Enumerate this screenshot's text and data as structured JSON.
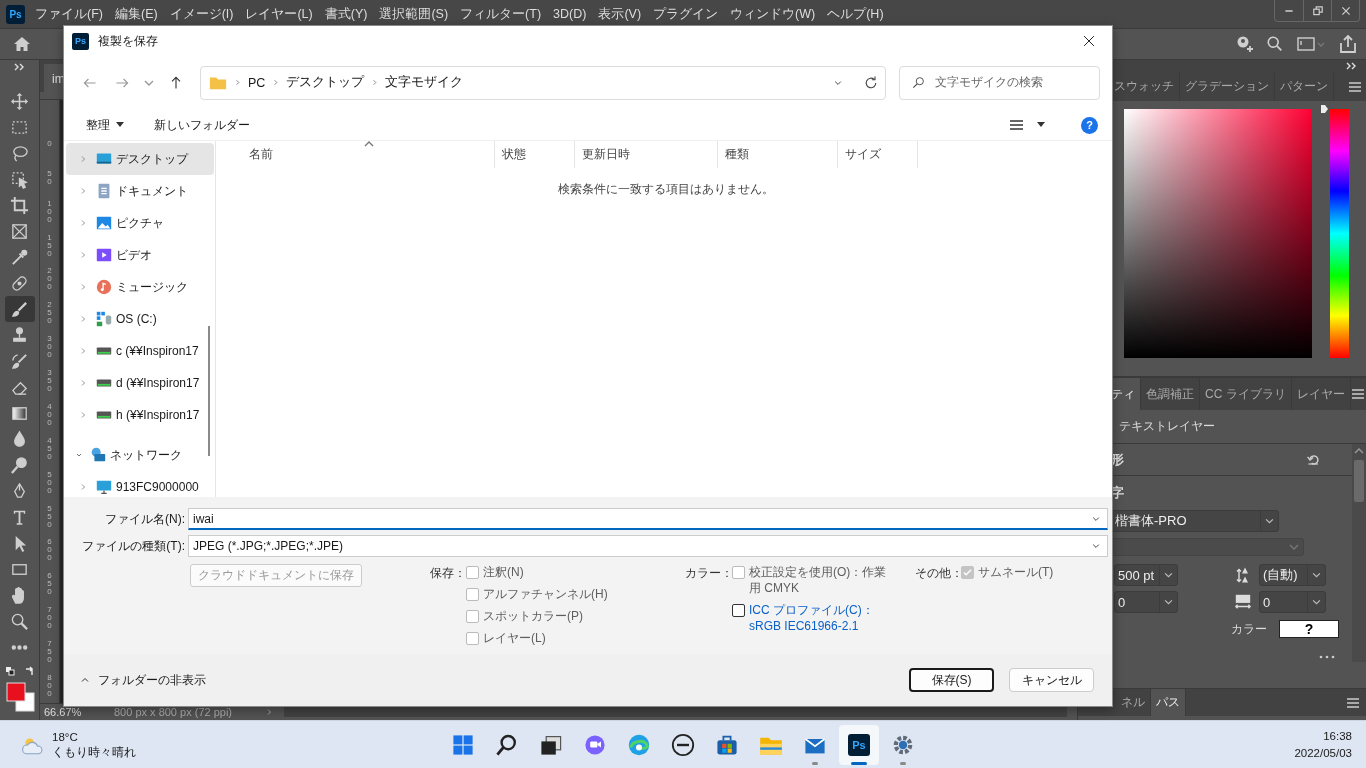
{
  "menu_bar": {
    "logo": "Ps",
    "items": [
      "ファイル(F)",
      "編集(E)",
      "イメージ(I)",
      "レイヤー(L)",
      "書式(Y)",
      "選択範囲(S)",
      "フィルター(T)",
      "3D(D)",
      "表示(V)",
      "プラグイン",
      "ウィンドウ(W)",
      "ヘルプ(H)"
    ]
  },
  "document_tab": {
    "label": "im"
  },
  "ruler": {
    "labels": [
      "0",
      "50",
      "100",
      "150",
      "200",
      "250",
      "300",
      "350",
      "400",
      "450",
      "500",
      "550",
      "600",
      "650",
      "700",
      "750",
      "800"
    ]
  },
  "tools": [
    {
      "kind": "move",
      "selected": false
    },
    {
      "kind": "marquee",
      "selected": false
    },
    {
      "kind": "lasso",
      "selected": false
    },
    {
      "kind": "object-select",
      "selected": false
    },
    {
      "kind": "crop",
      "selected": false
    },
    {
      "kind": "frame",
      "selected": false
    },
    {
      "kind": "eyedropper",
      "selected": false
    },
    {
      "kind": "healing",
      "selected": false
    },
    {
      "kind": "brush",
      "selected": true
    },
    {
      "kind": "stamp",
      "selected": false
    },
    {
      "kind": "history-brush",
      "selected": false
    },
    {
      "kind": "eraser",
      "selected": false
    },
    {
      "kind": "gradient",
      "selected": false
    },
    {
      "kind": "blur",
      "selected": false
    },
    {
      "kind": "dodge",
      "selected": false
    },
    {
      "kind": "pen",
      "selected": false
    },
    {
      "kind": "type",
      "selected": false
    },
    {
      "kind": "path-select",
      "selected": false
    },
    {
      "kind": "rectangle",
      "selected": false
    },
    {
      "kind": "hand",
      "selected": false
    },
    {
      "kind": "zoom",
      "selected": false
    },
    {
      "kind": "more",
      "selected": false
    }
  ],
  "swatches": [
    {
      "kind": "foreground",
      "color": "#e8101e"
    },
    {
      "kind": "background",
      "color": "#ffffff"
    }
  ],
  "status_bar": {
    "zoom": "66.67%",
    "document_size": "800 px x 800 px (72 ppi)"
  },
  "hue_slider": {
    "level": 1
  },
  "color_panel": {
    "tabs": [
      {
        "label": "スウォッチ",
        "selected": false
      },
      {
        "label": "グラデーション",
        "selected": false
      },
      {
        "label": "パターン",
        "selected": false
      }
    ]
  },
  "properties_panel": {
    "tabs": [
      {
        "label": "ティ",
        "selected": true
      },
      {
        "label": "色調補正",
        "selected": false
      },
      {
        "label": "CC ライブラリ",
        "selected": false
      },
      {
        "label": "レイヤー",
        "selected": false
      }
    ],
    "layer_kind": "テキストレイヤー",
    "transform_heading": "形",
    "character_heading": "字",
    "font_family": "楷書体-PRO",
    "font_size": "500 pt",
    "leading": "(自動)",
    "kerning": "0",
    "tracking": "0",
    "color_label": "カラー",
    "color_value": "?"
  },
  "bottom_tabs": [
    {
      "label": "ネル",
      "selected": false
    },
    {
      "label": "パス",
      "selected": true
    }
  ],
  "dialog": {
    "logo": "Ps",
    "title": "複製を保存",
    "breadcrumb": [
      "PC",
      "デスクトップ",
      "文字モザイク"
    ],
    "search_placeholder": "文字モザイクの検索",
    "organize": "整理",
    "new_folder": "新しいフォルダー",
    "help": "?",
    "nav_items": [
      {
        "label": "デスクトップ",
        "kind": "desktop",
        "expanded": false,
        "selected": true
      },
      {
        "label": "ドキュメント",
        "kind": "documents",
        "expanded": false,
        "selected": false
      },
      {
        "label": "ピクチャ",
        "kind": "pictures",
        "expanded": false,
        "selected": false
      },
      {
        "label": "ビデオ",
        "kind": "videos",
        "expanded": false,
        "selected": false
      },
      {
        "label": "ミュージック",
        "kind": "music",
        "expanded": false,
        "selected": false
      },
      {
        "label": "OS (C:)",
        "kind": "system-drive",
        "expanded": false,
        "selected": false
      },
      {
        "label": "c (¥¥Inspiron17",
        "kind": "network-drive",
        "expanded": false,
        "selected": false
      },
      {
        "label": "d (¥¥Inspiron17",
        "kind": "network-drive",
        "expanded": false,
        "selected": false
      },
      {
        "label": "h (¥¥Inspiron17",
        "kind": "network-drive",
        "expanded": false,
        "selected": false
      },
      {
        "label": "ネットワーク",
        "kind": "network",
        "expanded": true,
        "selected": false,
        "children": [
          {
            "label": "913FC9000000",
            "kind": "computer",
            "expanded": false,
            "selected": false
          }
        ]
      }
    ],
    "columns": [
      "名前",
      "状態",
      "更新日時",
      "種類",
      "サイズ"
    ],
    "empty_message": "検索条件に一致する項目はありません。",
    "file_name_label": "ファイル名(N):",
    "file_name": "iwai",
    "file_type_label": "ファイルの種類(T):",
    "file_type": "JPEG (*.JPG;*.JPEG;*.JPE)",
    "cloud_button": {
      "label": "クラウドドキュメントに保存",
      "disabled": true
    },
    "save_group": {
      "label": "保存：",
      "options": [
        {
          "label": "注釈(N)",
          "checked": false,
          "disabled": true
        },
        {
          "label": "アルファチャンネル(H)",
          "checked": false,
          "disabled": true
        },
        {
          "label": "スポットカラー(P)",
          "checked": false,
          "disabled": true
        },
        {
          "label": "レイヤー(L)",
          "checked": false,
          "disabled": true
        }
      ]
    },
    "color_group": {
      "label": "カラー：",
      "options": [
        {
          "label": "校正設定を使用(O)：作業用 CMYK",
          "checked": false,
          "disabled": true
        },
        {
          "label": "ICC プロファイル(C)：sRGB IEC61966-2.1",
          "checked": false,
          "disabled": false
        }
      ]
    },
    "other_group": {
      "label": "その他：",
      "options": [
        {
          "label": "サムネール(T)",
          "checked": true,
          "disabled": true
        }
      ]
    },
    "hide_folders": "フォルダーの非表示",
    "buttons": [
      {
        "label": "保存(S)",
        "kind": "primary"
      },
      {
        "label": "キャンセル",
        "kind": "secondary"
      }
    ]
  },
  "taskbar": {
    "temperature": "18°C",
    "weather": "くもり時々晴れ",
    "apps": [
      {
        "kind": "start",
        "running": false,
        "active": false
      },
      {
        "kind": "search",
        "running": false,
        "active": false
      },
      {
        "kind": "task-view",
        "running": false,
        "active": false
      },
      {
        "kind": "chat",
        "running": false,
        "active": false
      },
      {
        "kind": "browser",
        "running": false,
        "active": false
      },
      {
        "kind": "vendor",
        "running": false,
        "active": false
      },
      {
        "kind": "store",
        "running": false,
        "active": false
      },
      {
        "kind": "explorer",
        "running": false,
        "active": false
      },
      {
        "kind": "mail",
        "running": true,
        "active": false
      },
      {
        "kind": "photoshop",
        "running": true,
        "active": true,
        "logo": "Ps"
      },
      {
        "kind": "settings",
        "running": true,
        "active": false
      }
    ],
    "time": "16:38",
    "date": "2022/05/03"
  }
}
